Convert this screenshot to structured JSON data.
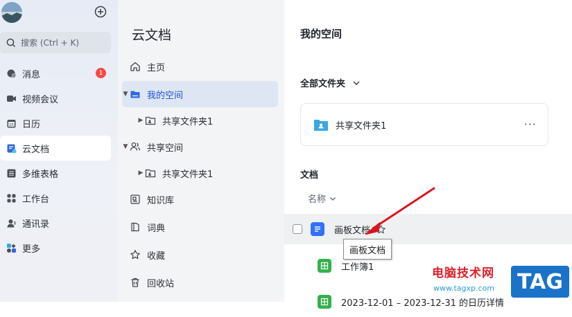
{
  "nav": {
    "search_placeholder": "搜索 (Ctrl + K)",
    "items": [
      {
        "label": "消息",
        "icon": "chat-bubble-icon",
        "badge": "1"
      },
      {
        "label": "视频会议",
        "icon": "video-camera-icon"
      },
      {
        "label": "日历",
        "icon": "calendar-icon"
      },
      {
        "label": "云文档",
        "icon": "cloud-doc-icon",
        "active": true
      },
      {
        "label": "多维表格",
        "icon": "table-icon"
      },
      {
        "label": "工作台",
        "icon": "grid-apps-icon"
      },
      {
        "label": "通讯录",
        "icon": "contacts-icon"
      },
      {
        "label": "更多",
        "icon": "more-apps-icon"
      }
    ]
  },
  "tree": {
    "title": "云文档",
    "items": [
      {
        "label": "主页"
      },
      {
        "label": "我的空间"
      },
      {
        "label": "共享文件夹1"
      },
      {
        "label": "共享空间"
      },
      {
        "label": "共享文件夹1"
      },
      {
        "label": "知识库"
      },
      {
        "label": "词典"
      },
      {
        "label": "收藏"
      },
      {
        "label": "回收站"
      }
    ]
  },
  "main": {
    "title": "我的空间",
    "folders_header": "全部文件夹",
    "folder_name": "共享文件夹1",
    "folder_more": "···",
    "docs_header": "文档",
    "sort_label": "名称",
    "docs": [
      {
        "name": "画板文档",
        "type": "doc"
      },
      {
        "name": "工作簿1",
        "type": "sheet"
      },
      {
        "name": "2023-12-01 – 2023-12-31 的日历详情",
        "type": "sheet"
      }
    ],
    "tooltip": "画板文档"
  },
  "watermark": {
    "cn": "电脑技术网",
    "url": "www.tagxp.com",
    "tag": "TAG"
  },
  "colors": {
    "accent": "#1f4fd6",
    "doc_blue": "#3370ff",
    "sheet_green": "#34b04c",
    "folder_blue": "#3aa7e6",
    "badge_red": "#f54a45",
    "arrow_red": "#d9151f"
  }
}
